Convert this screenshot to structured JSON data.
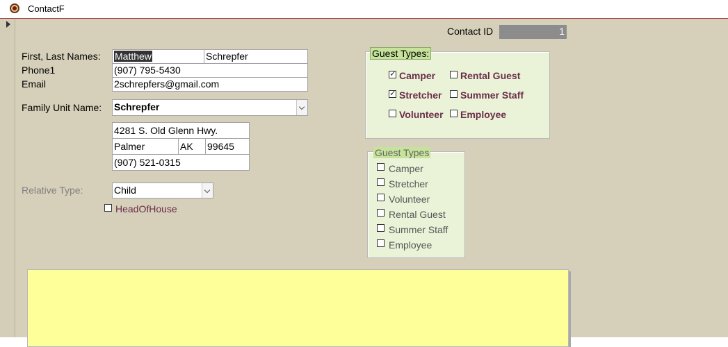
{
  "window": {
    "title": "ContactF"
  },
  "contact_id": {
    "label": "Contact ID",
    "value": "1"
  },
  "person": {
    "names_label": "First, Last Names:",
    "first_name": "Matthew",
    "last_name": "Schrepfer",
    "phone_label": "Phone1",
    "phone": "(907) 795-5430",
    "email_label": "Email",
    "email": "2schrepfers@gmail.com"
  },
  "family": {
    "label": "Family Unit Name:",
    "value": "Schrepfer",
    "address": "4281 S. Old Glenn Hwy.",
    "city": "Palmer",
    "state": "AK",
    "zip": "99645",
    "phone": "(907) 521-0315"
  },
  "relative": {
    "label": "Relative Type:",
    "value": "Child"
  },
  "head_of_house": {
    "label": "HeadOfHouse",
    "checked": false
  },
  "guest_types_bound": {
    "caption": "Guest Types:",
    "items": [
      {
        "label": "Camper",
        "checked": true
      },
      {
        "label": "Rental Guest",
        "checked": false
      },
      {
        "label": "Stretcher",
        "checked": true
      },
      {
        "label": "Summer Staff",
        "checked": false
      },
      {
        "label": "Volunteer",
        "checked": false
      },
      {
        "label": "Employee",
        "checked": false
      }
    ]
  },
  "guest_types_unbound": {
    "caption": "Guest Types",
    "items": [
      {
        "label": "Camper",
        "checked": false
      },
      {
        "label": "Stretcher",
        "checked": false
      },
      {
        "label": "Volunteer",
        "checked": false
      },
      {
        "label": "Rental Guest",
        "checked": false
      },
      {
        "label": "Summer Staff",
        "checked": false
      },
      {
        "label": "Employee",
        "checked": false
      }
    ]
  },
  "colors": {
    "form_bg": "#d6cfb9",
    "frame_bg": "#eaf2d7",
    "caption_bg": "#c6e39b",
    "notes_bg": "#ffff99",
    "checkbox_label_bound": "#6b2d4a",
    "checkbox_label_unbound": "#555555",
    "disabled_label": "#808080"
  }
}
